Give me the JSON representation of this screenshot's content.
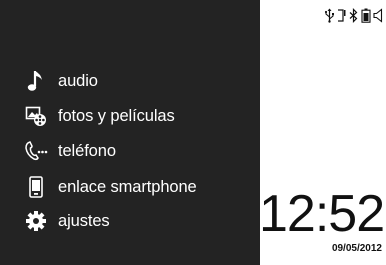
{
  "menu": {
    "items": [
      {
        "label": "audio",
        "icon": "music-note-icon"
      },
      {
        "label": "fotos y películas",
        "icon": "photo-film-icon"
      },
      {
        "label": "teléfono",
        "icon": "phone-icon"
      },
      {
        "label": "enlace smartphone",
        "icon": "smartphone-icon"
      },
      {
        "label": "ajustes",
        "icon": "gear-icon"
      }
    ]
  },
  "status": {
    "icons": [
      "usb-icon",
      "phone-handset-icon",
      "bluetooth-icon",
      "battery-icon",
      "volume-icon"
    ]
  },
  "clock": {
    "time": "12:52",
    "date": "09/05/2012"
  },
  "colors": {
    "panel_background": "#232323",
    "menu_text": "#ffffff",
    "screen_background": "#ffffff",
    "clock_text": "#111111"
  }
}
